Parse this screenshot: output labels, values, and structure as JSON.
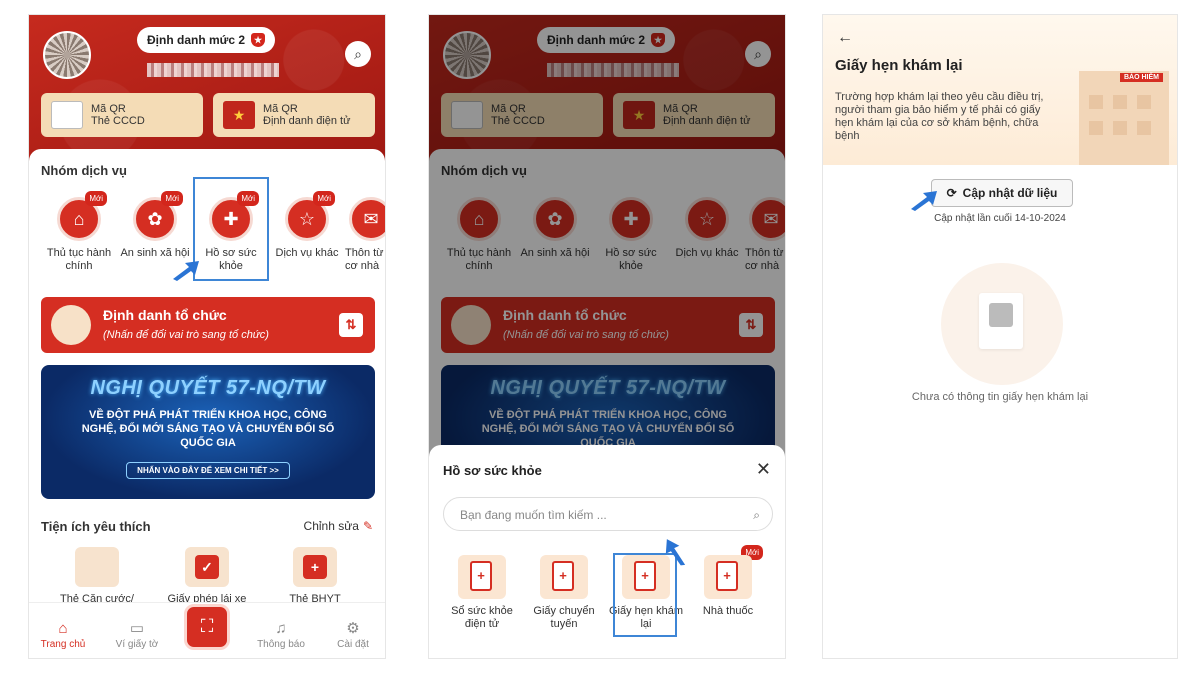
{
  "home": {
    "id_level": "Định danh mức 2",
    "qr_cccd": {
      "line1": "Mã QR",
      "line2": "Thẻ CCCD"
    },
    "qr_vneid": {
      "line1": "Mã QR",
      "line2": "Định danh điện tử"
    },
    "services_title": "Nhóm dịch vụ",
    "new_badge": "Mới",
    "services": [
      {
        "label": "Thủ tục hành chính",
        "icon": "courthouse-icon"
      },
      {
        "label": "An sinh xã hội",
        "icon": "flower-icon"
      },
      {
        "label": "Hồ sơ sức khỏe",
        "icon": "health-shield-icon"
      },
      {
        "label": "Dịch vụ khác",
        "icon": "star-icon"
      },
      {
        "label": "Thôn từ cơ nhà",
        "icon": "service-icon"
      }
    ],
    "org": {
      "title": "Định danh tổ chức",
      "subtitle": "(Nhấn để đổi vai trò sang tổ chức)"
    },
    "banner": {
      "title": "NGHỊ QUYẾT 57-NQ/TW",
      "body": "VỀ ĐỘT PHÁ PHÁT TRIỂN KHOA HỌC, CÔNG NGHỆ, ĐỔI MỚI SÁNG TẠO VÀ CHUYỂN ĐỔI SỐ QUỐC GIA",
      "cta": "NHẤN VÀO ĐÂY ĐỂ XEM CHI TIẾT >>"
    },
    "favorites_title": "Tiện ích yêu thích",
    "favorites_edit": "Chỉnh sửa",
    "favorites": [
      "Thẻ Căn cước/",
      "Giấy phép lái xe",
      "Thẻ BHYT"
    ],
    "nav": [
      {
        "label": "Trang chủ",
        "icon": "home-icon"
      },
      {
        "label": "Ví giấy tờ",
        "icon": "wallet-icon"
      },
      {
        "label": "Thông báo",
        "icon": "bell-icon"
      },
      {
        "label": "Cài đặt",
        "icon": "settings-icon"
      }
    ]
  },
  "health_sheet": {
    "title": "Hồ sơ sức khỏe",
    "search_placeholder": "Bạn đang muốn tìm kiếm ...",
    "new_badge": "Mới",
    "items": [
      "Sổ sức khỏe điện tử",
      "Giấy chuyển tuyến",
      "Giấy hẹn khám lại",
      "Nhà thuốc"
    ]
  },
  "appointment": {
    "title": "Giấy hẹn khám lại",
    "description": "Trường hợp khám lại theo yêu cầu điều trị, người tham gia bảo hiểm y tế phải có giấy hẹn khám lại của cơ sở khám bệnh, chữa bệnh",
    "building_sign": "BẢO HIỂM",
    "update_button": "Cập nhật dữ liệu",
    "last_update": "Cập nhật lần cuối 14-10-2024",
    "empty_message": "Chưa có thông tin giấy hẹn khám lại"
  },
  "colors": {
    "brand_red": "#d52e22",
    "highlight_blue": "#3e86d6",
    "banner_blue": "#0b2a66"
  }
}
